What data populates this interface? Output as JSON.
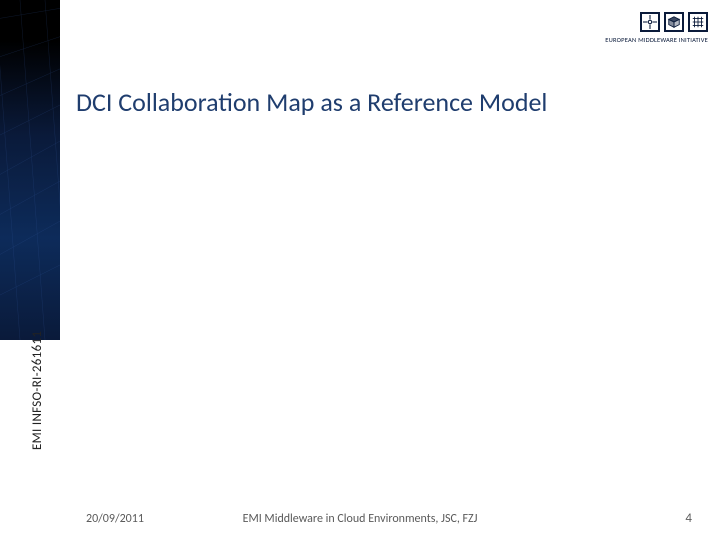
{
  "colors": {
    "title": "#1f3d6e",
    "sidebar_dark": "#000000",
    "sidebar_blue": "#0d2b5a"
  },
  "logo": {
    "caption": "EUROPEAN MIDDLEWARE INITIATIVE",
    "icons": [
      "circuit-icon",
      "cube-icon",
      "globe-icon"
    ]
  },
  "title": "DCI Collaboration Map as a Reference Model",
  "project_ref": "EMI INFSO-RI-261611",
  "footer": {
    "date": "20/09/2011",
    "center": "EMI Middleware in Cloud Environments, JSC, FZJ",
    "page_number": "4"
  }
}
